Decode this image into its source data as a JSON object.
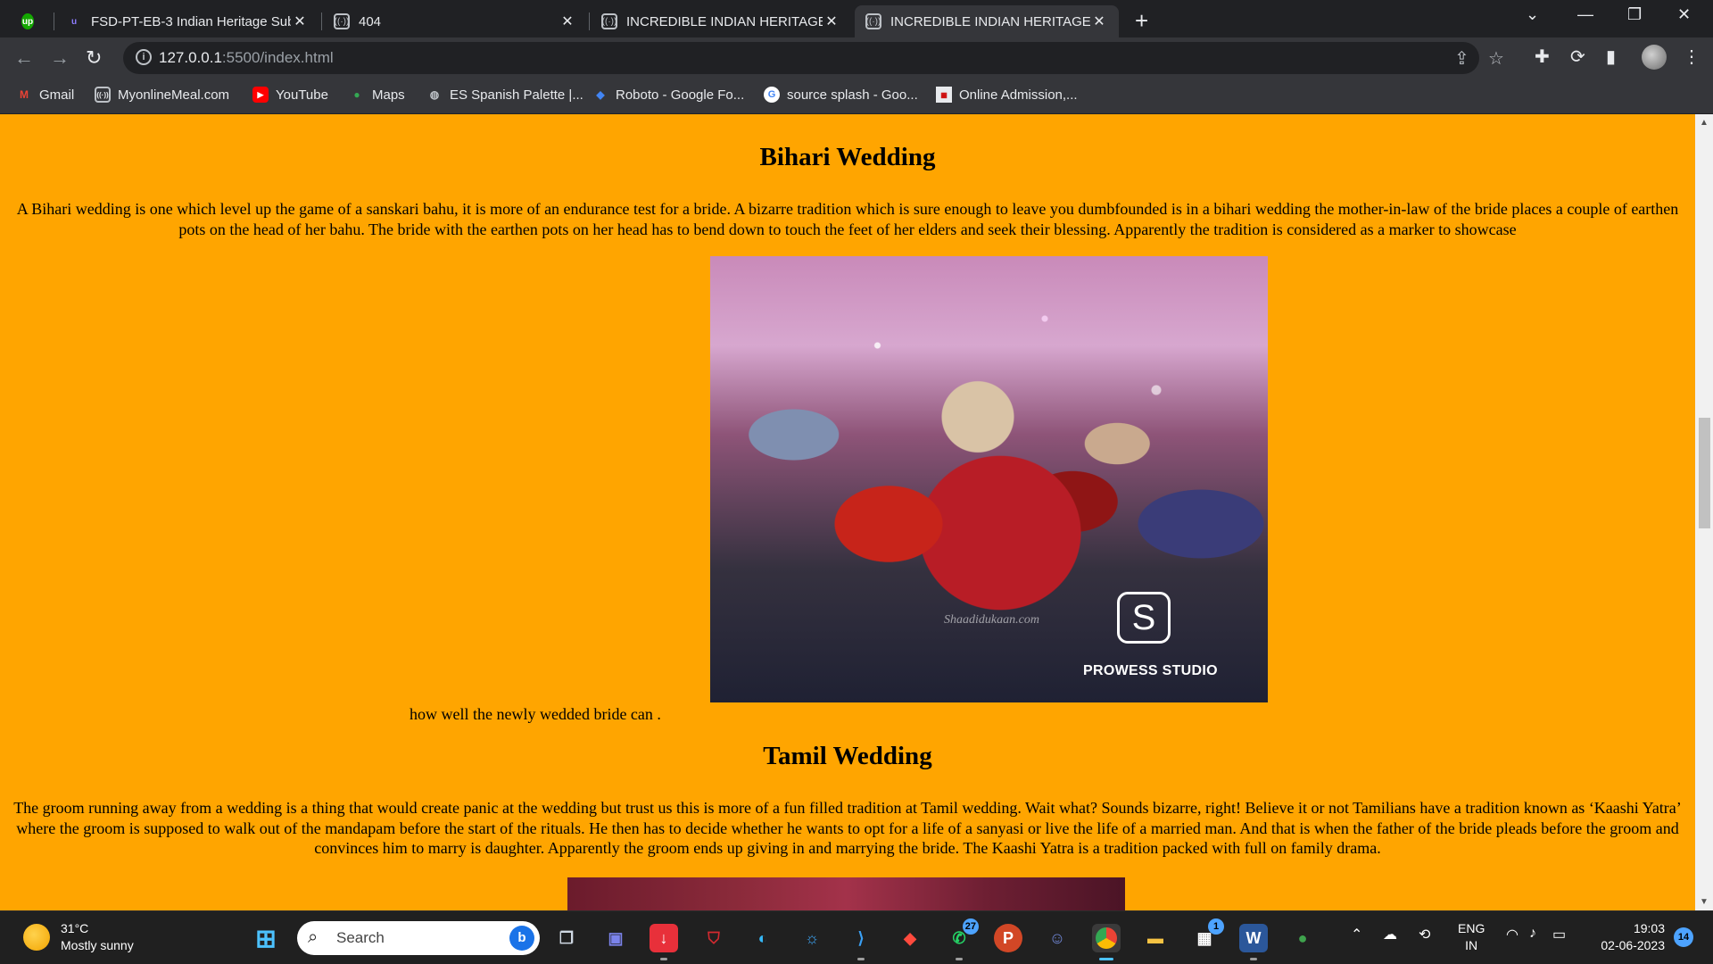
{
  "browser": {
    "tabs": [
      {
        "title": "FSD-PT-EB-3 Indian Heritage Sub",
        "favicon": "upwork-icon"
      },
      {
        "title": "404",
        "favicon": "live-server-icon"
      },
      {
        "title": "INCREDIBLE INDIAN HERITAGE",
        "favicon": "live-server-icon"
      },
      {
        "title": "INCREDIBLE INDIAN HERITAGE",
        "favicon": "live-server-icon",
        "active": true
      }
    ],
    "url_host": "127.0.0.1",
    "url_rest": ":5500/index.html",
    "bookmarks": [
      {
        "label": "Gmail"
      },
      {
        "label": "MyonlineMeal.com"
      },
      {
        "label": "YouTube"
      },
      {
        "label": "Maps"
      },
      {
        "label": "ES Spanish Palette |..."
      },
      {
        "label": "Roboto - Google Fo..."
      },
      {
        "label": "source splash - Goo..."
      },
      {
        "label": "Online Admission,..."
      }
    ]
  },
  "page": {
    "bihari": {
      "heading": "Bihari Wedding",
      "paragraph": "A Bihari wedding is one which level up the game of a sanskari bahu, it is more of an endurance test for a bride. A bizarre tradition which is sure enough to leave you dumbfounded is in a bihari wedding the mother-in-law of the bride places a couple of earthen pots on the head of her bahu. The bride with the earthen pots on her head has to bend down to touch the feet of her elders and seek their blessing. Apparently the tradition is considered as a marker to showcase",
      "tail": "how well the newly wedded bride can .",
      "photo_brand": "PROWESS STUDIO",
      "photo_watermark": "Shaadidukaan.com"
    },
    "tamil": {
      "heading": "Tamil Wedding",
      "paragraph": "The groom running away from a wedding is a thing that would create panic at the wedding but trust us this is more of a fun filled tradition at Tamil wedding. Wait what? Sounds bizarre, right! Believe it or not Tamilians have a tradition known as ‘Kaashi Yatra’ where the groom is supposed to walk out of the mandapam before the start of the rituals. He then has to decide whether he wants to opt for a life of a sanyasi or live the life of a married man. And that is when the father of the bride pleads before the groom and convinces him to marry is daughter. Apparently the groom ends up giving in and marrying the bride. The Kaashi Yatra is a tradition packed with full on family drama."
    }
  },
  "taskbar": {
    "weather_temp": "31°C",
    "weather_desc": "Mostly sunny",
    "search_placeholder": "Search",
    "whatsapp_badge": "27",
    "store_badge": "1",
    "lang_top": "ENG",
    "lang_bottom": "IN",
    "time": "19:03",
    "date": "02-06-2023",
    "notif_count": "14"
  }
}
